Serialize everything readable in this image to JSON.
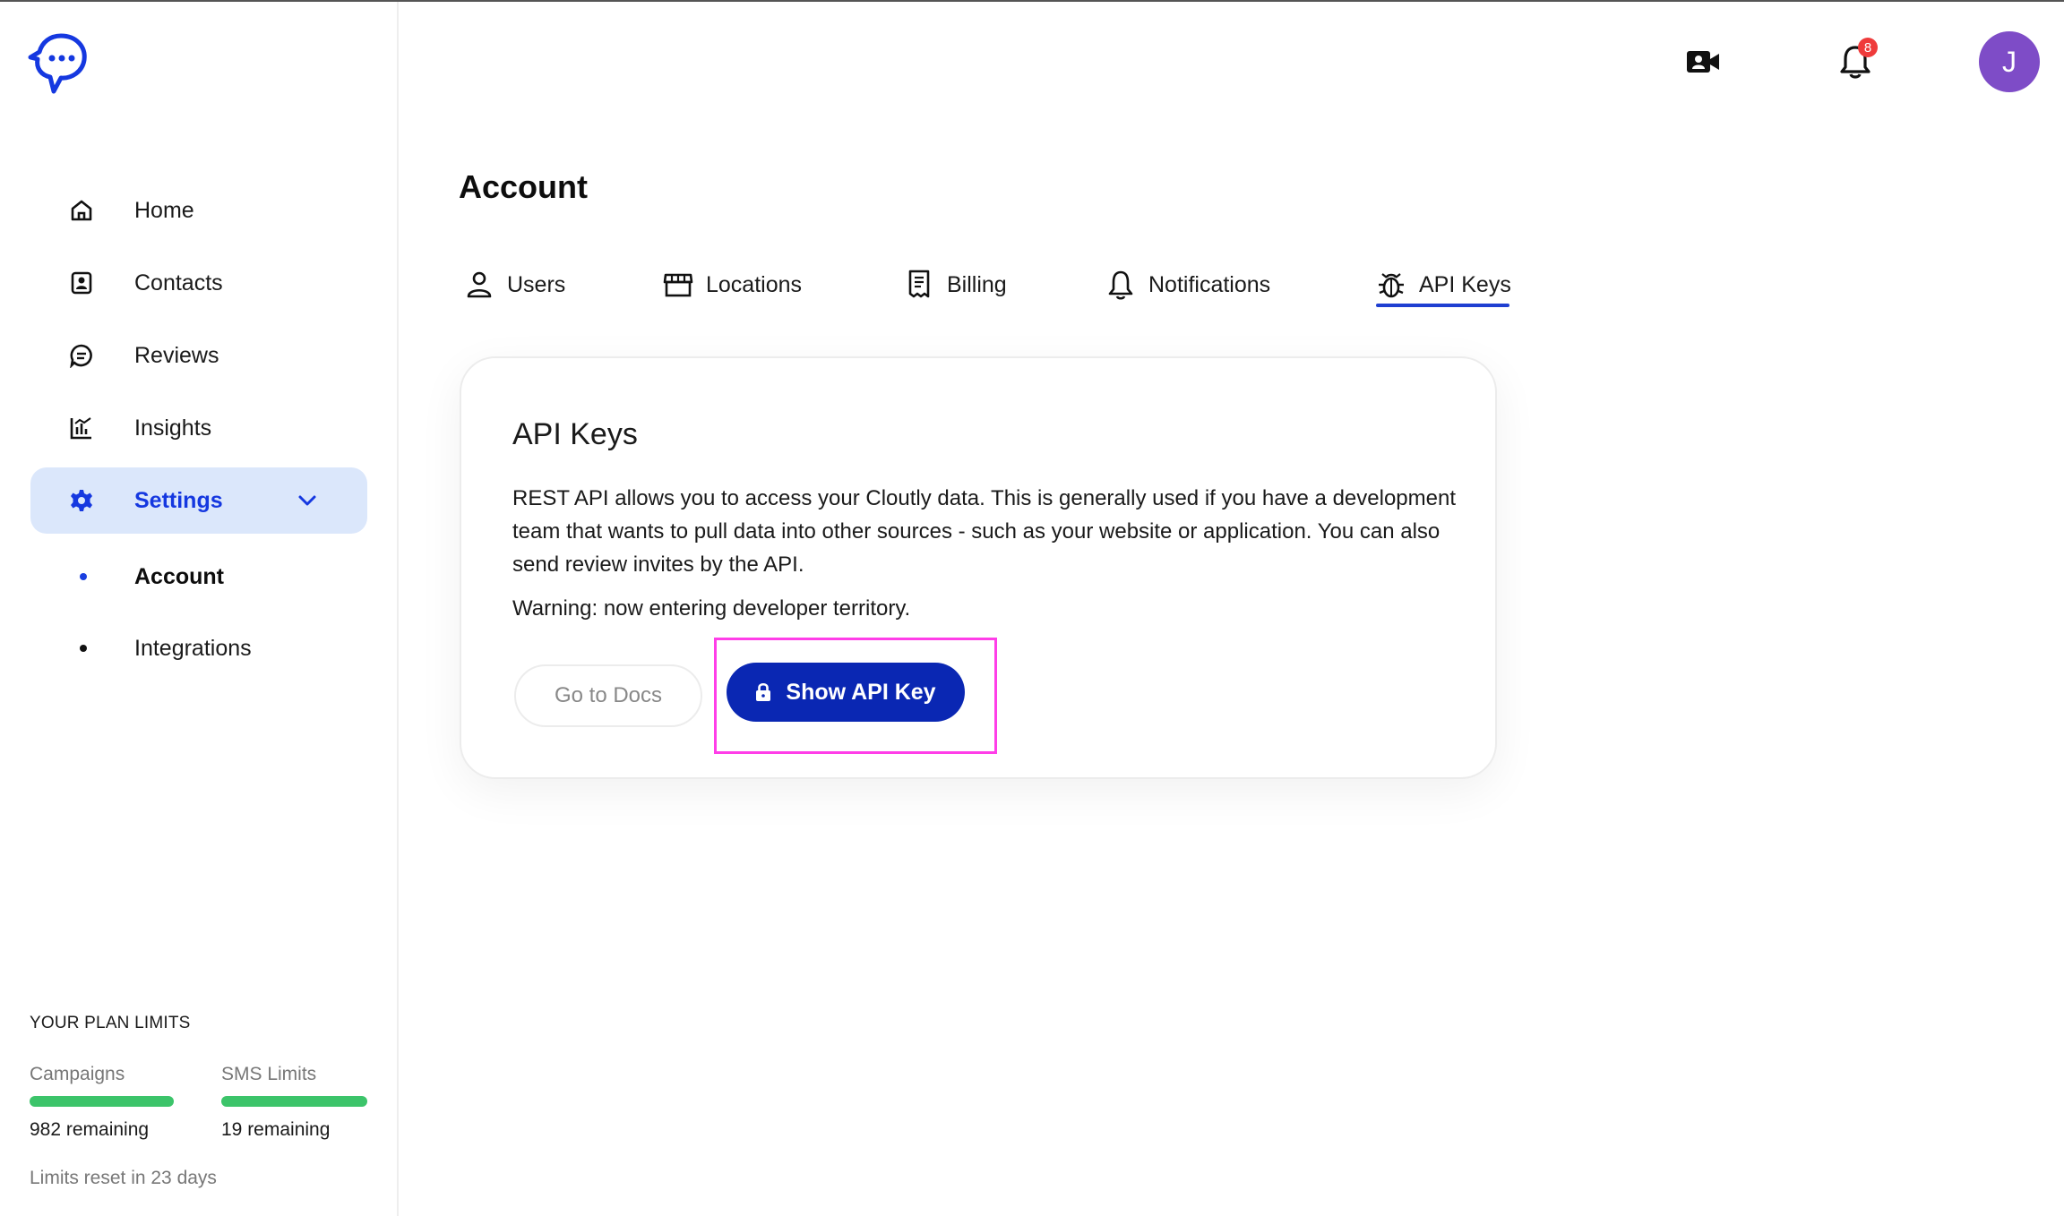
{
  "sidebar": {
    "nav": [
      {
        "label": "Home",
        "icon": "home-icon"
      },
      {
        "label": "Contacts",
        "icon": "contacts-icon"
      },
      {
        "label": "Reviews",
        "icon": "reviews-icon"
      },
      {
        "label": "Insights",
        "icon": "insights-icon"
      },
      {
        "label": "Settings",
        "icon": "gear-icon",
        "active": true
      }
    ],
    "sub": [
      {
        "label": "Account",
        "active": true
      },
      {
        "label": "Integrations"
      }
    ],
    "plan": {
      "title": "YOUR PLAN LIMITS",
      "campaigns_label": "Campaigns",
      "campaigns_remaining": "982 remaining",
      "campaigns_fill": 1.0,
      "sms_label": "SMS Limits",
      "sms_remaining": "19 remaining",
      "sms_fill": 1.0,
      "reset": "Limits reset in 23 days"
    }
  },
  "header": {
    "notification_count": "8",
    "avatar_initial": "J"
  },
  "main": {
    "title": "Account",
    "tabs": [
      {
        "label": "Users",
        "icon": "user-icon"
      },
      {
        "label": "Locations",
        "icon": "store-icon"
      },
      {
        "label": "Billing",
        "icon": "receipt-icon"
      },
      {
        "label": "Notifications",
        "icon": "bell-icon"
      },
      {
        "label": "API Keys",
        "icon": "bug-icon",
        "active": true
      }
    ],
    "card": {
      "title": "API Keys",
      "description": "REST API allows you to access your Cloutly data. This is generally used if you have a development team that wants to pull data into other sources - such as your website or application. You can also send review invites by the API.",
      "warning": "Warning: now entering developer territory.",
      "docs_button": "Go to Docs",
      "show_key_button": "Show API Key"
    }
  },
  "colors": {
    "accent": "#1538e0",
    "button_primary": "#0a27b3",
    "active_bg": "#dbe7fb",
    "progress": "#3cc46a",
    "avatar": "#7e4cc7",
    "badge": "#ef3b3b",
    "highlight": "#ff3ee8"
  }
}
